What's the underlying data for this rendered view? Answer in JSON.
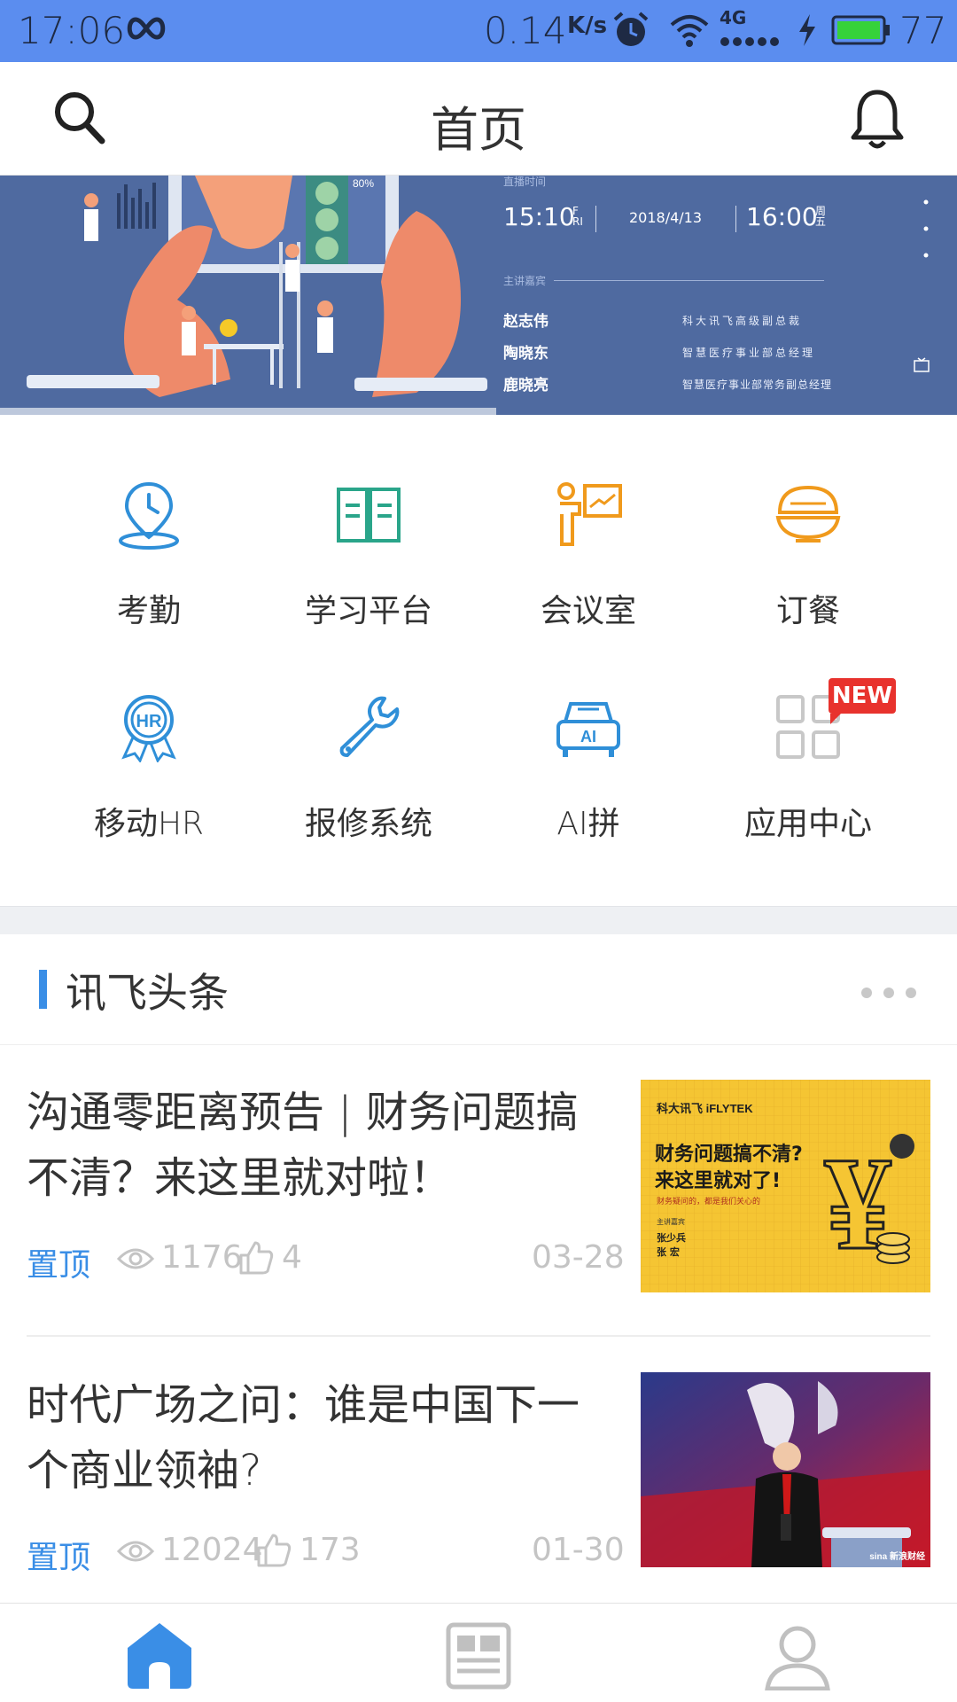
{
  "status_bar": {
    "time": "17:06",
    "speed": "0.14",
    "speed_unit": "K/s",
    "network": "4G",
    "battery": "77",
    "icons": [
      "infinity-icon",
      "alarm-icon",
      "wifi-icon",
      "signal-icon",
      "charging-icon",
      "battery-icon"
    ]
  },
  "header": {
    "title": "首页",
    "icons": [
      "search-icon",
      "bell-icon"
    ]
  },
  "banner": {
    "label_time": "直播时间",
    "time_start": "15:10",
    "day_start": "FRI",
    "date": "2018/4/13",
    "time_end": "16:00",
    "day_end": "周五",
    "guests_label": "主讲嘉宾",
    "screen_percent": "80%",
    "guests": [
      {
        "name": "赵志伟",
        "role": "科大讯飞高级副总裁"
      },
      {
        "name": "陶晓东",
        "role": "智慧医疗事业部总经理"
      },
      {
        "name": "鹿晓亮",
        "role": "智慧医疗事业部常务副总经理"
      }
    ]
  },
  "apps": [
    {
      "label": "考勤",
      "icon": "location-clock-icon",
      "color": "#2f8fd8"
    },
    {
      "label": "学习平台",
      "icon": "book-icon",
      "color": "#2aa58a"
    },
    {
      "label": "会议室",
      "icon": "presentation-icon",
      "color": "#f09a1c"
    },
    {
      "label": "订餐",
      "icon": "bowl-icon",
      "color": "#f09a1c"
    },
    {
      "label": "移动HR",
      "icon": "hr-badge-icon",
      "color": "#2f8fd8"
    },
    {
      "label": "报修系统",
      "icon": "wrench-icon",
      "color": "#2f8fd8"
    },
    {
      "label": "AI拼",
      "icon": "ai-car-icon",
      "color": "#2f8fd8"
    },
    {
      "label": "应用中心",
      "icon": "grid-apps-icon",
      "color": "#c8c8c8"
    }
  ],
  "new_badge": "NEW",
  "news": {
    "section_title": "讯飞头条",
    "articles": [
      {
        "headline": "沟通零距离预告 | 财务问题搞不清？来这里就对啦！",
        "pin": "置顶",
        "views": "1176",
        "likes": "4",
        "date": "03-28",
        "image": {
          "brand": "科大讯飞 iFLYTEK",
          "title_line1": "财务问题搞不清?",
          "title_line2": "来这里就对了!",
          "subtitle": "财务疑问的，都是我们关心的",
          "label": "主讲嘉宾",
          "speaker1": "张少兵",
          "speaker2": "张 宏"
        }
      },
      {
        "headline": "时代广场之问：谁是中国下一个商业领袖?",
        "pin": "置顶",
        "views": "12024",
        "likes": "173",
        "date": "01-30",
        "image": {
          "watermark": "sina 新浪财经"
        }
      }
    ]
  },
  "bottom_nav": [
    {
      "name": "home",
      "icon": "home-icon",
      "active": true
    },
    {
      "name": "news",
      "icon": "news-icon",
      "active": false
    },
    {
      "name": "profile",
      "icon": "profile-icon",
      "active": false
    }
  ]
}
